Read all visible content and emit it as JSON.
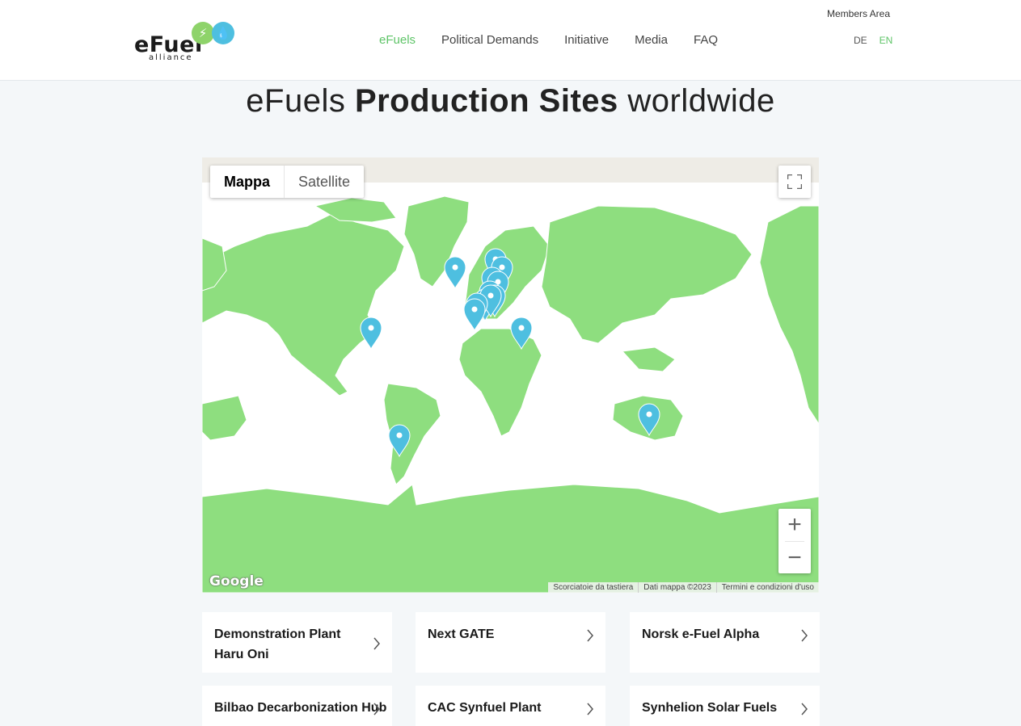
{
  "header": {
    "logo": {
      "main": "eFuel",
      "sub": "alliance"
    },
    "nav": [
      {
        "label": "eFuels",
        "active": true
      },
      {
        "label": "Political Demands",
        "active": false
      },
      {
        "label": "Initiative",
        "active": false
      },
      {
        "label": "Media",
        "active": false
      },
      {
        "label": "FAQ",
        "active": false
      }
    ],
    "members": "Members Area",
    "languages": [
      {
        "label": "DE",
        "active": false
      },
      {
        "label": "EN",
        "active": true
      }
    ]
  },
  "headline": {
    "pre": "eFuels ",
    "bold": "Production Sites",
    "post": " worldwide"
  },
  "map": {
    "types": {
      "map": "Mappa",
      "satellite": "Satellite"
    },
    "google": "Google",
    "attribution": [
      "Scorciatoie da tastiera",
      "Dati mappa ©2023",
      "Termini e condizioni d'uso"
    ],
    "land_color": "#8ede7f",
    "marker_color": "#4ebfe0",
    "icons": {
      "fullscreen": "fullscreen-icon",
      "zoom_in": "plus-icon",
      "zoom_out": "minus-icon",
      "marker": "map-pin-icon"
    }
  },
  "sites": [
    {
      "title": "Demonstration Plant Haru Oni"
    },
    {
      "title": "Next GATE"
    },
    {
      "title": "Norsk e-Fuel Alpha"
    },
    {
      "title": "Bilbao Decarbonization Hub"
    },
    {
      "title": "CAC Synfuel Plant"
    },
    {
      "title": "Synhelion Solar Fuels"
    }
  ],
  "colors": {
    "accent": "#5ec467",
    "background": "#f4f7f9"
  }
}
